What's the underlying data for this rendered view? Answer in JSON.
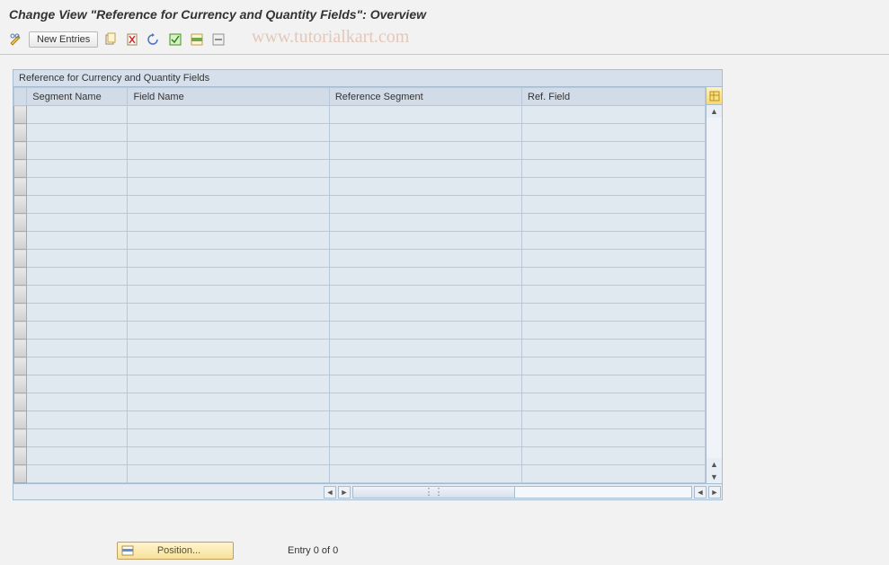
{
  "title": "Change View \"Reference for Currency and Quantity Fields\": Overview",
  "toolbar": {
    "new_entries_label": "New Entries"
  },
  "table": {
    "caption": "Reference for Currency and Quantity Fields",
    "columns": {
      "segment_name": "Segment Name",
      "field_name": "Field Name",
      "reference_segment": "Reference Segment",
      "ref_field": "Ref. Field"
    },
    "rows": [
      {
        "segment_name": "",
        "field_name": "",
        "reference_segment": "",
        "ref_field": ""
      },
      {
        "segment_name": "",
        "field_name": "",
        "reference_segment": "",
        "ref_field": ""
      },
      {
        "segment_name": "",
        "field_name": "",
        "reference_segment": "",
        "ref_field": ""
      },
      {
        "segment_name": "",
        "field_name": "",
        "reference_segment": "",
        "ref_field": ""
      },
      {
        "segment_name": "",
        "field_name": "",
        "reference_segment": "",
        "ref_field": ""
      },
      {
        "segment_name": "",
        "field_name": "",
        "reference_segment": "",
        "ref_field": ""
      },
      {
        "segment_name": "",
        "field_name": "",
        "reference_segment": "",
        "ref_field": ""
      },
      {
        "segment_name": "",
        "field_name": "",
        "reference_segment": "",
        "ref_field": ""
      },
      {
        "segment_name": "",
        "field_name": "",
        "reference_segment": "",
        "ref_field": ""
      },
      {
        "segment_name": "",
        "field_name": "",
        "reference_segment": "",
        "ref_field": ""
      },
      {
        "segment_name": "",
        "field_name": "",
        "reference_segment": "",
        "ref_field": ""
      },
      {
        "segment_name": "",
        "field_name": "",
        "reference_segment": "",
        "ref_field": ""
      },
      {
        "segment_name": "",
        "field_name": "",
        "reference_segment": "",
        "ref_field": ""
      },
      {
        "segment_name": "",
        "field_name": "",
        "reference_segment": "",
        "ref_field": ""
      },
      {
        "segment_name": "",
        "field_name": "",
        "reference_segment": "",
        "ref_field": ""
      },
      {
        "segment_name": "",
        "field_name": "",
        "reference_segment": "",
        "ref_field": ""
      },
      {
        "segment_name": "",
        "field_name": "",
        "reference_segment": "",
        "ref_field": ""
      },
      {
        "segment_name": "",
        "field_name": "",
        "reference_segment": "",
        "ref_field": ""
      },
      {
        "segment_name": "",
        "field_name": "",
        "reference_segment": "",
        "ref_field": ""
      },
      {
        "segment_name": "",
        "field_name": "",
        "reference_segment": "",
        "ref_field": ""
      },
      {
        "segment_name": "",
        "field_name": "",
        "reference_segment": "",
        "ref_field": ""
      }
    ]
  },
  "footer": {
    "position_label": "Position...",
    "entry_status": "Entry 0 of 0"
  },
  "watermark": "www.tutorialkart.com",
  "icons": {
    "toggle": "toggle-icon",
    "copy": "copy-icon",
    "delete": "delete-icon",
    "undo": "undo-icon",
    "select_all": "select-all-icon",
    "select_block": "select-block-icon",
    "deselect_all": "deselect-all-icon",
    "table_settings": "table-settings-icon",
    "position": "position-icon"
  }
}
